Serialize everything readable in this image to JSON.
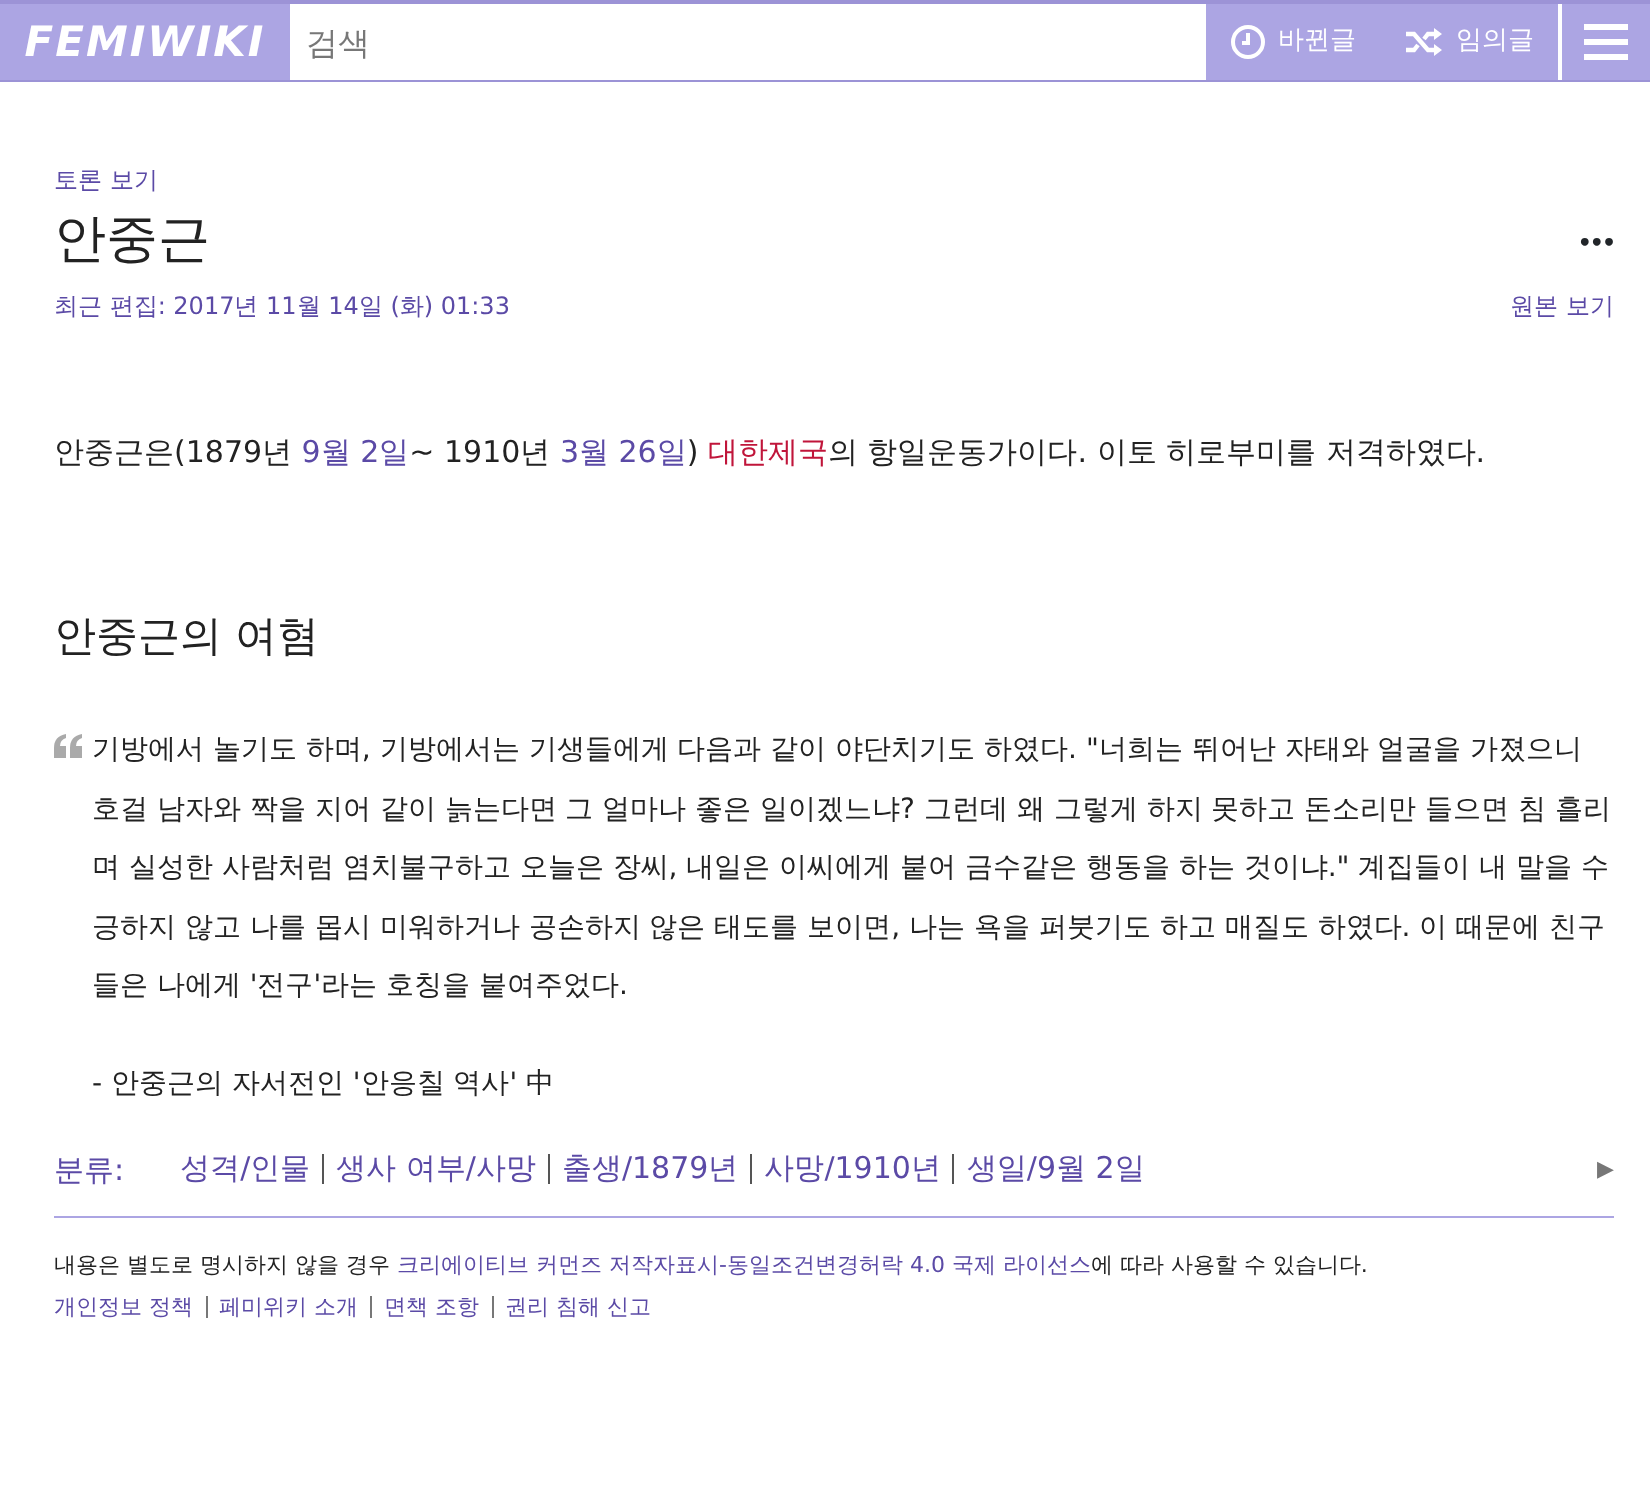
{
  "header": {
    "logo": "FEMIWIKI",
    "search": {
      "placeholder": "검색"
    },
    "buttons": [
      {
        "kind": "recent",
        "label": "바뀐글"
      },
      {
        "kind": "random",
        "label": "임의글"
      }
    ]
  },
  "page": {
    "talk_link": "토론 보기",
    "title": "안중근",
    "more": "•••",
    "last_edit": "최근 편집: 2017년 11월 14일 (화) 01:33",
    "source_link": "원본 보기"
  },
  "intro": [
    {
      "kind": "text",
      "text": "안중근은(1879년 "
    },
    {
      "kind": "link",
      "text": "9월 2일"
    },
    {
      "kind": "text",
      "text": "~ 1910년 "
    },
    {
      "kind": "link",
      "text": "3월 26일"
    },
    {
      "kind": "text",
      "text": ") "
    },
    {
      "kind": "redlink",
      "text": "대한제국"
    },
    {
      "kind": "text",
      "text": "의 항일운동가이다. 이토 히로부미를 저격하였다."
    }
  ],
  "section": {
    "heading": "안중근의 여혐",
    "quote": "기방에서 놀기도 하며, 기방에서는 기생들에게 다음과 같이 야단치기도 하였다. \"너희는 뛰어난 자태와 얼굴을 가졌으니 호걸 남자와 짝을 지어 같이 늙는다면 그 얼마나 좋은 일이겠느냐?  그런데 왜 그렇게 하지 못하고 돈소리만 들으면 침 흘리며 실성한 사람처럼 염치불구하고 오늘은 장씨, 내일은 이씨에게 붙어 금수같은 행동을 하는 것이냐.\" 계집들이 내 말을 수긍하지 않고 나를 몹시 미워하거나 공손하지 않은 태도를 보이면, 나는 욕을 퍼붓기도 하고 매질도 하였다. 이 때문에 친구들은 나에게 '전구'라는 호칭을 붙여주었다.",
    "attribution": "- 안중근의 자서전인 '안응칠 역사' 中"
  },
  "categories": {
    "label": "분류:",
    "items": [
      "성격/인물",
      "생사 여부/사망",
      "출생/1879년",
      "사망/1910년",
      "생일/9월 2일"
    ],
    "toggle": "▶"
  },
  "footer": {
    "license": [
      {
        "kind": "text",
        "text": "내용은 별도로 명시하지 않을 경우 "
      },
      {
        "kind": "link",
        "text": "크리에이티브 커먼즈 저작자표시-동일조건변경허락 4.0 국제 라이선스"
      },
      {
        "kind": "text",
        "text": "에 따라 사용할 수 있습니다."
      }
    ],
    "links": [
      "개인정보 정책",
      "페미위키 소개",
      "면책 조항",
      "권리 침해 신고"
    ]
  }
}
